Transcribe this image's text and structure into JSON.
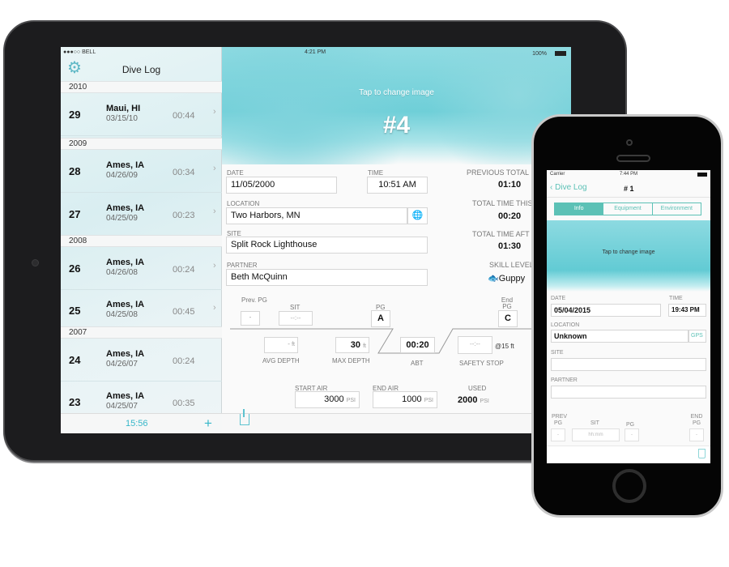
{
  "ipad": {
    "status": {
      "carrier": "●●●○○ BELL",
      "time": "4:21 PM",
      "battery": "100%"
    },
    "sidebar": {
      "title": "Dive Log",
      "total_time": "15:56",
      "sections": [
        {
          "year": "2010",
          "dives": [
            {
              "num": "29",
              "location": "Maui, HI",
              "date": "03/15/10",
              "duration": "00:44"
            }
          ]
        },
        {
          "year": "2009",
          "dives": [
            {
              "num": "28",
              "location": "Ames, IA",
              "date": "04/26/09",
              "duration": "00:34"
            },
            {
              "num": "27",
              "location": "Ames, IA",
              "date": "04/25/09",
              "duration": "00:23"
            }
          ]
        },
        {
          "year": "2008",
          "dives": [
            {
              "num": "26",
              "location": "Ames, IA",
              "date": "04/26/08",
              "duration": "00:24"
            },
            {
              "num": "25",
              "location": "Ames, IA",
              "date": "04/25/08",
              "duration": "00:45"
            }
          ]
        },
        {
          "year": "2007",
          "dives": [
            {
              "num": "24",
              "location": "Ames, IA",
              "date": "04/26/07",
              "duration": "00:24"
            },
            {
              "num": "23",
              "location": "Ames, IA",
              "date": "04/25/07",
              "duration": "00:35"
            }
          ]
        }
      ]
    },
    "detail": {
      "tap_hint": "Tap to change image",
      "dive_number": "#4",
      "date_label": "DATE",
      "date": "11/05/2000",
      "time_label": "TIME",
      "time": "10:51 AM",
      "location_label": "LOCATION",
      "location": "Two Harbors, MN",
      "site_label": "SITE",
      "site": "Split Rock Lighthouse",
      "partner_label": "PARTNER",
      "partner": "Beth McQuinn",
      "previous_total_label": "PREVIOUS TOTAL",
      "previous_total": "01:10",
      "total_this_label": "TOTAL TIME THIS",
      "total_this": "00:20",
      "total_after_label": "TOTAL TIME AFT",
      "total_after": "01:30",
      "skill_label": "SKILL LEVEL",
      "skill": "Guppy",
      "prev_pg_label": "Prev. PG",
      "prev_pg": "-",
      "sit_label": "SIT",
      "sit": "--:--",
      "pg_label": "PG",
      "pg": "A",
      "end_pg_label": "End PG",
      "end_pg": "C",
      "avg_depth": "-",
      "avg_depth_label": "AVG DEPTH",
      "max_depth": "30",
      "max_depth_label": "MAX DEPTH",
      "depth_unit": "ft",
      "abt": "00:20",
      "abt_label": "ABT",
      "safety_stop": "--:--",
      "safety_stop_label": "SAFETY STOP",
      "safety_depth": "@15 ft",
      "start_air_label": "START AIR",
      "start_air": "3000",
      "end_air_label": "END AIR",
      "end_air": "1000",
      "used_label": "USED",
      "used": "2000",
      "pressure_unit": "PSI"
    }
  },
  "iphone": {
    "status": {
      "carrier": "Carrier",
      "time": "7:44 PM"
    },
    "back_label": "Dive Log",
    "title": "# 1",
    "tabs": [
      "Info",
      "Equipment",
      "Environment"
    ],
    "active_tab": "Info",
    "tap_hint": "Tap to change image",
    "date_label": "DATE",
    "date": "05/04/2015",
    "time_label": "TIME",
    "time": "19:43 PM",
    "location_label": "LOCATION",
    "location": "Unknown",
    "gps_label": "GPS",
    "site_label": "SITE",
    "site": "",
    "partner_label": "PARTNER",
    "partner": "",
    "prev_pg_label": "PREV PG",
    "prev_pg": "-",
    "sit_label": "SIT",
    "sit_placeholder": "hh:mm",
    "pg_label": "PG",
    "pg": "-",
    "end_pg_label": "END PG",
    "end_pg": "-"
  }
}
